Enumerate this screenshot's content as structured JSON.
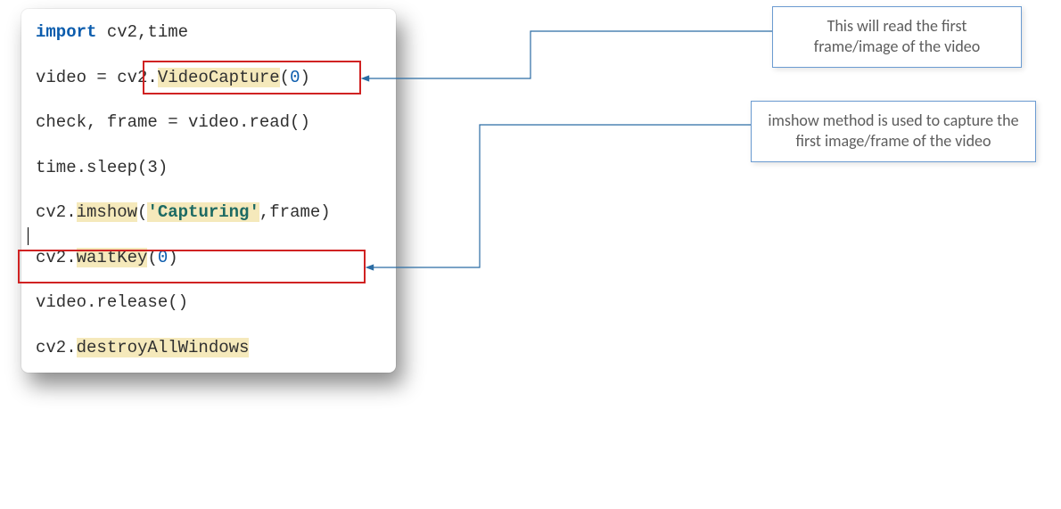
{
  "code": {
    "line1_kw": "import",
    "line1_rest": " cv2,time",
    "line2_a": "video = cv2.",
    "line2_b": "VideoCapture",
    "line2_c": "(",
    "line2_num": "0",
    "line2_d": ")",
    "line3": "check, frame = video.read()",
    "line4": "time.sleep(3)",
    "line5_a": "cv2.",
    "line5_b": "imshow",
    "line5_c": "(",
    "line5_str": "'Capturing'",
    "line5_d": ",frame)",
    "line6_a": "cv2.",
    "line6_b": "waitKey",
    "line6_c": "(",
    "line6_num": "0",
    "line6_d": ")",
    "line7": "video.release()",
    "line8_a": "cv2.",
    "line8_b": "destroyAllWindows"
  },
  "callouts": {
    "c1": "This will read the first frame/image of the video",
    "c2": "imshow method is used to capture the first image/frame of the video"
  },
  "colors": {
    "connector": "#2b6ca3",
    "highlight_border": "#d02222"
  }
}
